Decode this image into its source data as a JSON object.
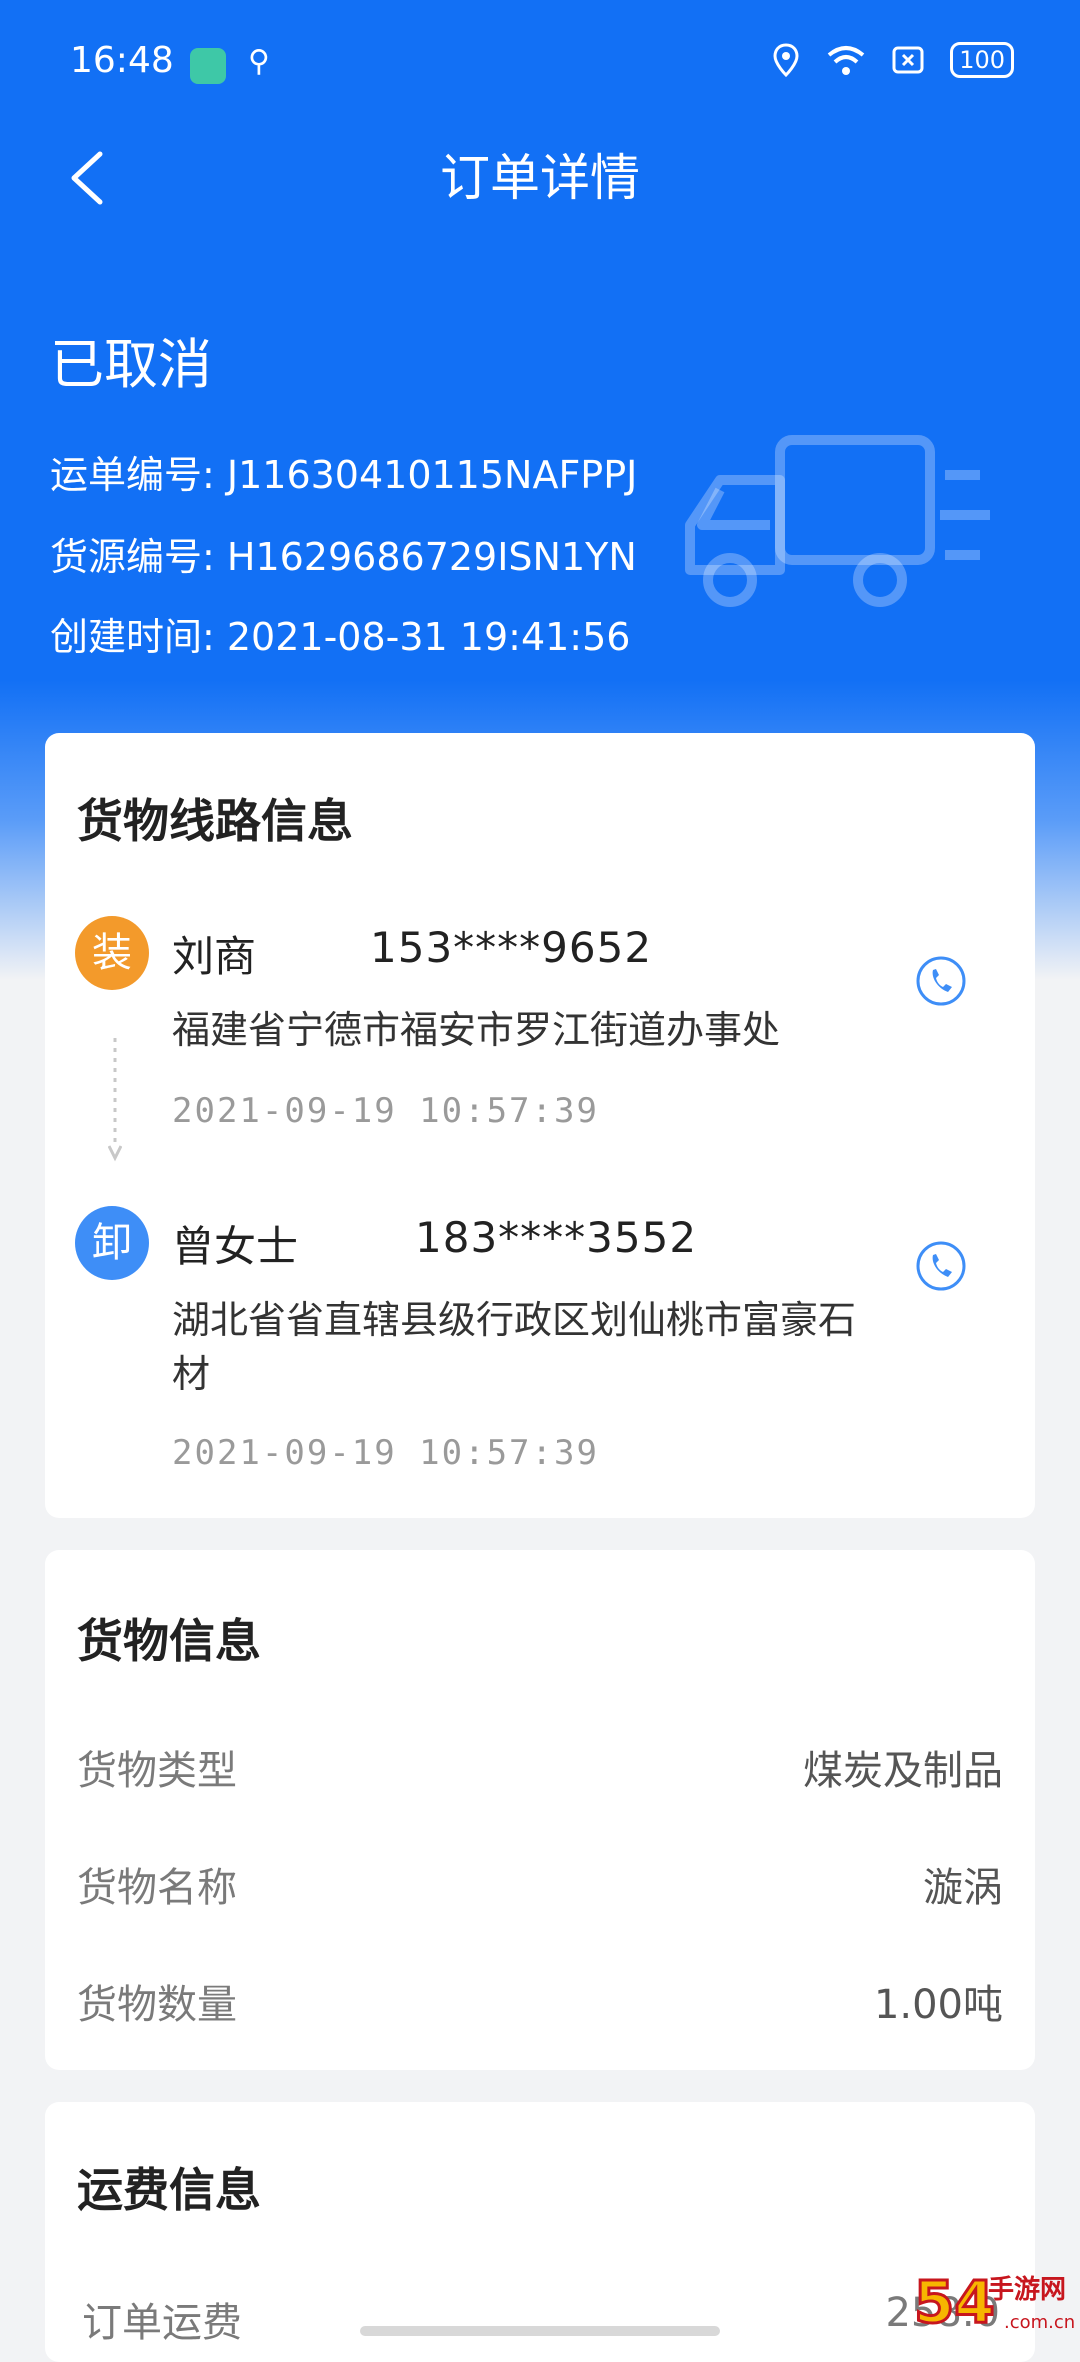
{
  "status_bar": {
    "time": "16:48",
    "battery": "100"
  },
  "nav": {
    "title": "订单详情"
  },
  "order": {
    "status": "已取消",
    "waybill_no": "运单编号: J11630410115NAFPPJ",
    "source_no": "货源编号: H1629686729ISN1YN",
    "created_at": "创建时间: 2021-08-31 19:41:56"
  },
  "route": {
    "title": "货物线路信息",
    "loading": {
      "badge": "装",
      "name": "刘商",
      "phone": "153****9652",
      "address": "福建省宁德市福安市罗江街道办事处",
      "time": "2021-09-19 10:57:39"
    },
    "unloading": {
      "badge": "卸",
      "name": "曾女士",
      "phone": "183****3552",
      "address": "湖北省省直辖县级行政区划仙桃市富豪石材",
      "time": "2021-09-19 10:57:39"
    }
  },
  "goods": {
    "title": "货物信息",
    "rows": [
      {
        "label": "货物类型",
        "value": "煤炭及制品"
      },
      {
        "label": "货物名称",
        "value": "漩涡"
      },
      {
        "label": "货物数量",
        "value": "1.00吨"
      }
    ]
  },
  "freight": {
    "title": "运费信息",
    "partial_row_label": "订单运费",
    "partial_row_value": "258.0"
  },
  "watermark": "54网 手游网",
  "colors": {
    "primary": "#1270F5",
    "loading_badge": "#F39A2B",
    "unloading_badge": "#3E8EF7"
  },
  "icons": [
    "back-chevron-icon",
    "truck-icon",
    "phone-call-icon",
    "location-icon",
    "wifi-icon",
    "sim-icon",
    "usb-icon"
  ]
}
